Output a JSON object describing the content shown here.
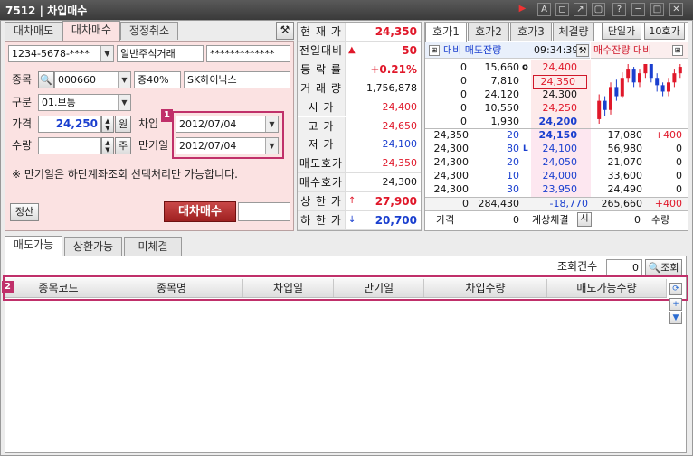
{
  "window": {
    "code": "7512",
    "title": "차입매수",
    "buttons": [
      "▶",
      "A",
      "◻",
      "↗",
      "▢",
      "?",
      "─",
      "□",
      "✕"
    ]
  },
  "top_tabs": [
    {
      "label": "대차매도"
    },
    {
      "label": "대차매수"
    },
    {
      "label": "정정취소"
    }
  ],
  "form": {
    "account": "1234-5678-****",
    "account_type": "일반주식거래",
    "password": "*************",
    "stock_label": "종목",
    "stock_code": "000660",
    "margin": "증40%",
    "stock_name": "SK하이닉스",
    "type_label": "구분",
    "type_value": "01.보통",
    "price_label": "가격",
    "price_value": "24,250",
    "price_unit": "원",
    "qty_label": "수량",
    "qty_unit": "주",
    "borrow_label": "차입",
    "borrow_date": "2012/07/04",
    "due_label": "만기일",
    "due_date": "2012/07/04",
    "notice": "※ 만기일은 하단계좌조회 선택처리만 가능합니다.",
    "settle_button": "정산",
    "buy_button": "대차매수",
    "badge1": "1"
  },
  "quote": [
    {
      "k": "현 재 가",
      "v": "24,350",
      "c": "red",
      "bold": true
    },
    {
      "k": "전일대비",
      "v": "50",
      "c": "red",
      "arrow": "▲",
      "bold": true
    },
    {
      "k": "등 락 률",
      "v": "+0.21%",
      "c": "red",
      "bold": true
    },
    {
      "k": "거 래 량",
      "v": "1,756,878",
      "c": "dk"
    },
    {
      "k": "시   가",
      "v": "24,400",
      "c": "red"
    },
    {
      "k": "고   가",
      "v": "24,650",
      "c": "red"
    },
    {
      "k": "저   가",
      "v": "24,100",
      "c": "blue"
    },
    {
      "k": "매도호가",
      "v": "24,350",
      "c": "red"
    },
    {
      "k": "매수호가",
      "v": "24,300",
      "c": "dk"
    },
    {
      "k": "상 한 가",
      "v": "27,900",
      "c": "red",
      "arrow": "↑",
      "bold": true
    },
    {
      "k": "하 한 가",
      "v": "20,700",
      "c": "blue",
      "arrow": "↓",
      "bold": true
    }
  ],
  "orderbook": {
    "tabs": [
      "호가1",
      "호가2",
      "호가3",
      "체결량"
    ],
    "tabs_right": [
      "단일가",
      "10호가"
    ],
    "header_left": "대비 매도잔량",
    "time": "09:34:39",
    "header_right": "매수잔량 대비",
    "asks": [
      {
        "diff": "0",
        "qty": "15,660",
        "price": "24,400",
        "mark": "o"
      },
      {
        "diff": "0",
        "qty": "7,810",
        "price": "24,350"
      },
      {
        "diff": "0",
        "qty": "24,120",
        "price": "24,300"
      },
      {
        "diff": "0",
        "qty": "10,550",
        "price": "24,250"
      },
      {
        "diff": "0",
        "qty": "1,930",
        "price": "24,200"
      }
    ],
    "bids": [
      {
        "lp": "24,350",
        "lq": "20",
        "price": "24,150",
        "qty": "17,080",
        "diff": "+400"
      },
      {
        "lp": "24,300",
        "lq": "80",
        "price": "24,100",
        "qty": "56,980",
        "diff": "0",
        "mark": "L"
      },
      {
        "lp": "24,300",
        "lq": "20",
        "price": "24,050",
        "qty": "21,070",
        "diff": "0"
      },
      {
        "lp": "24,300",
        "lq": "10",
        "price": "24,000",
        "qty": "33,600",
        "diff": "0"
      },
      {
        "lp": "24,300",
        "lq": "30",
        "price": "23,950",
        "qty": "24,490",
        "diff": "0"
      }
    ],
    "total": {
      "diff_l": "0",
      "ask_total": "284,430",
      "net": "-18,770",
      "bid_total": "265,660",
      "diff_r": "+400"
    },
    "footer": {
      "price_label": "가격",
      "price_val": "0",
      "mid": "계상체결",
      "btn": "시",
      "qty_val": "0",
      "qty_label": "수량"
    },
    "candles": [
      {
        "o": 24050,
        "c": 24250,
        "h": 24320,
        "l": 24000
      },
      {
        "o": 24250,
        "c": 24150,
        "h": 24300,
        "l": 24080
      },
      {
        "o": 24150,
        "c": 24400,
        "h": 24450,
        "l": 24100
      },
      {
        "o": 24400,
        "c": 24300,
        "h": 24480,
        "l": 24250
      },
      {
        "o": 24300,
        "c": 24500,
        "h": 24560,
        "l": 24280
      },
      {
        "o": 24500,
        "c": 24600,
        "h": 24650,
        "l": 24450
      },
      {
        "o": 24600,
        "c": 24450,
        "h": 24620,
        "l": 24400
      },
      {
        "o": 24450,
        "c": 24550,
        "h": 24600,
        "l": 24400
      },
      {
        "o": 24550,
        "c": 24650,
        "h": 24650,
        "l": 24500
      },
      {
        "o": 24650,
        "c": 24500,
        "h": 24650,
        "l": 24450
      },
      {
        "o": 24500,
        "c": 24420,
        "h": 24550,
        "l": 24350
      },
      {
        "o": 24420,
        "c": 24350,
        "h": 24450,
        "l": 24300
      },
      {
        "o": 24350,
        "c": 24450,
        "h": 24500,
        "l": 24300
      },
      {
        "o": 24450,
        "c": 24550,
        "h": 24600,
        "l": 24400
      },
      {
        "o": 24550,
        "c": 24620,
        "h": 24650,
        "l": 24500
      }
    ]
  },
  "bottom": {
    "tabs": [
      "매도가능",
      "상환가능",
      "미체결"
    ],
    "count_label": "조회건수",
    "count_value": "0",
    "query_button": "조회",
    "badge2": "2",
    "columns": [
      "종목코드",
      "종목명",
      "차입일",
      "만기일",
      "차입수량",
      "매도가능수량"
    ]
  }
}
